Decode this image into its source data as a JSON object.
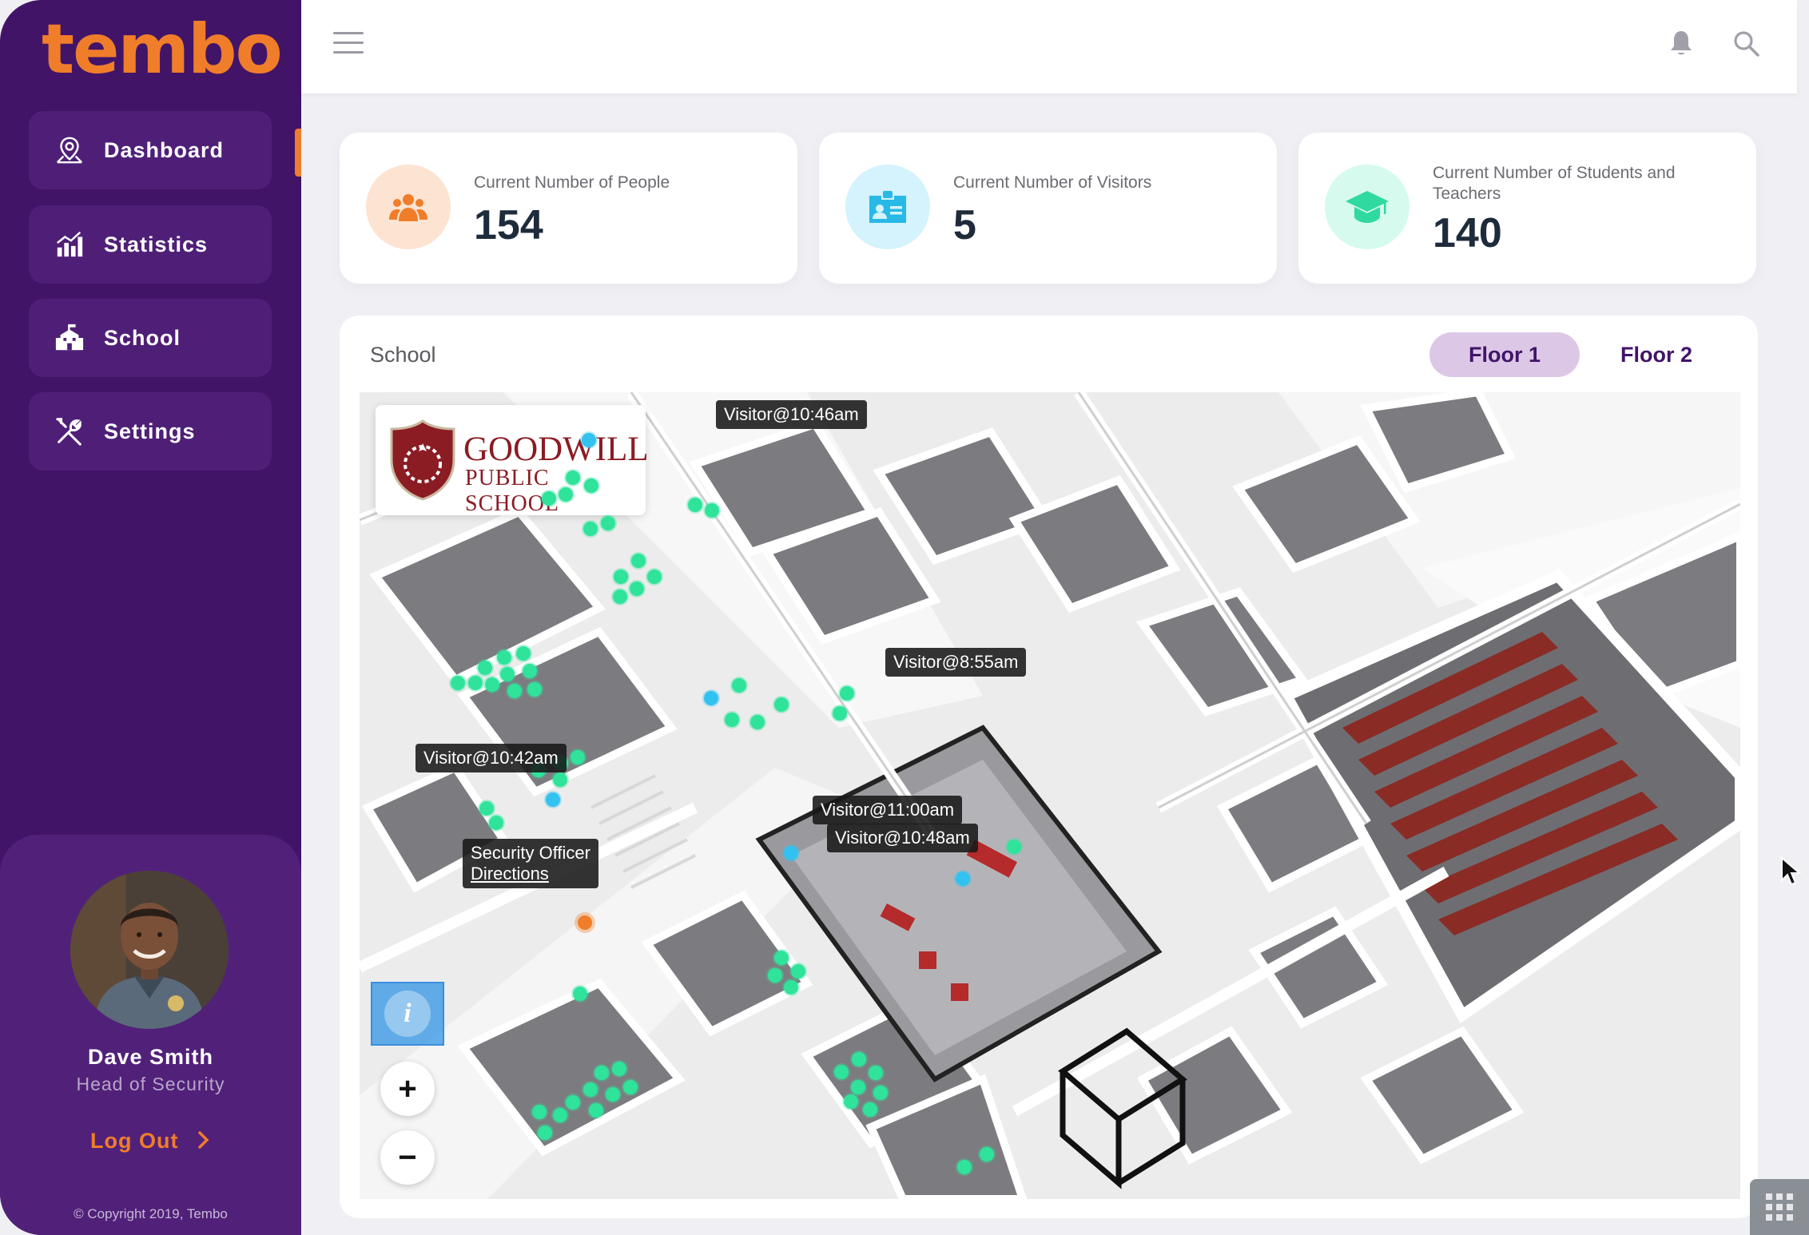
{
  "brand": {
    "logo_text": "tembo",
    "accent": "#f07d2a",
    "sidebar_bg": "#421468"
  },
  "nav": {
    "items": [
      {
        "label": "Dashboard",
        "icon": "map-pin-icon",
        "active": true
      },
      {
        "label": "Statistics",
        "icon": "bar-chart-icon",
        "active": false
      },
      {
        "label": "School",
        "icon": "school-building-icon",
        "active": false
      },
      {
        "label": "Settings",
        "icon": "wrench-screwdriver-icon",
        "active": false
      }
    ]
  },
  "profile": {
    "name": "Dave Smith",
    "role": "Head of Security",
    "logout_label": "Log Out",
    "copyright": "© Copyright 2019, Tembo"
  },
  "topbar": {
    "menu_icon": "hamburger-icon",
    "notifications_icon": "bell-icon",
    "search_icon": "search-icon"
  },
  "stats": [
    {
      "label": "Current Number of People",
      "value": "154",
      "icon": "people-group-icon",
      "color": "#f07d2a",
      "bg": "#fde3d2"
    },
    {
      "label": "Current Number of Visitors",
      "value": "5",
      "icon": "id-badge-icon",
      "color": "#28b9e6",
      "bg": "#d4f3fc"
    },
    {
      "label": "Current Number of Students and Teachers",
      "value": "140",
      "icon": "graduation-cap-icon",
      "color": "#2fd9a0",
      "bg": "#d6faee"
    }
  ],
  "map_panel": {
    "title": "School",
    "floors": [
      {
        "label": "Floor 1",
        "active": true
      },
      {
        "label": "Floor 2",
        "active": false
      }
    ],
    "school_badge": {
      "name": "GOODWILL",
      "subtitle": "PUBLIC SCHOOL"
    },
    "tags": {
      "visitor_1046": "Visitor@10:46am",
      "visitor_855": "Visitor@8:55am",
      "visitor_1042": "Visitor@10:42am",
      "visitor_1100": "Visitor@11:00am",
      "visitor_1048": "Visitor@10:48am",
      "security_officer": "Security Officer",
      "directions_link": "Directions"
    },
    "controls": {
      "info_icon": "info-icon",
      "zoom_in": "+",
      "zoom_out": "−"
    }
  }
}
